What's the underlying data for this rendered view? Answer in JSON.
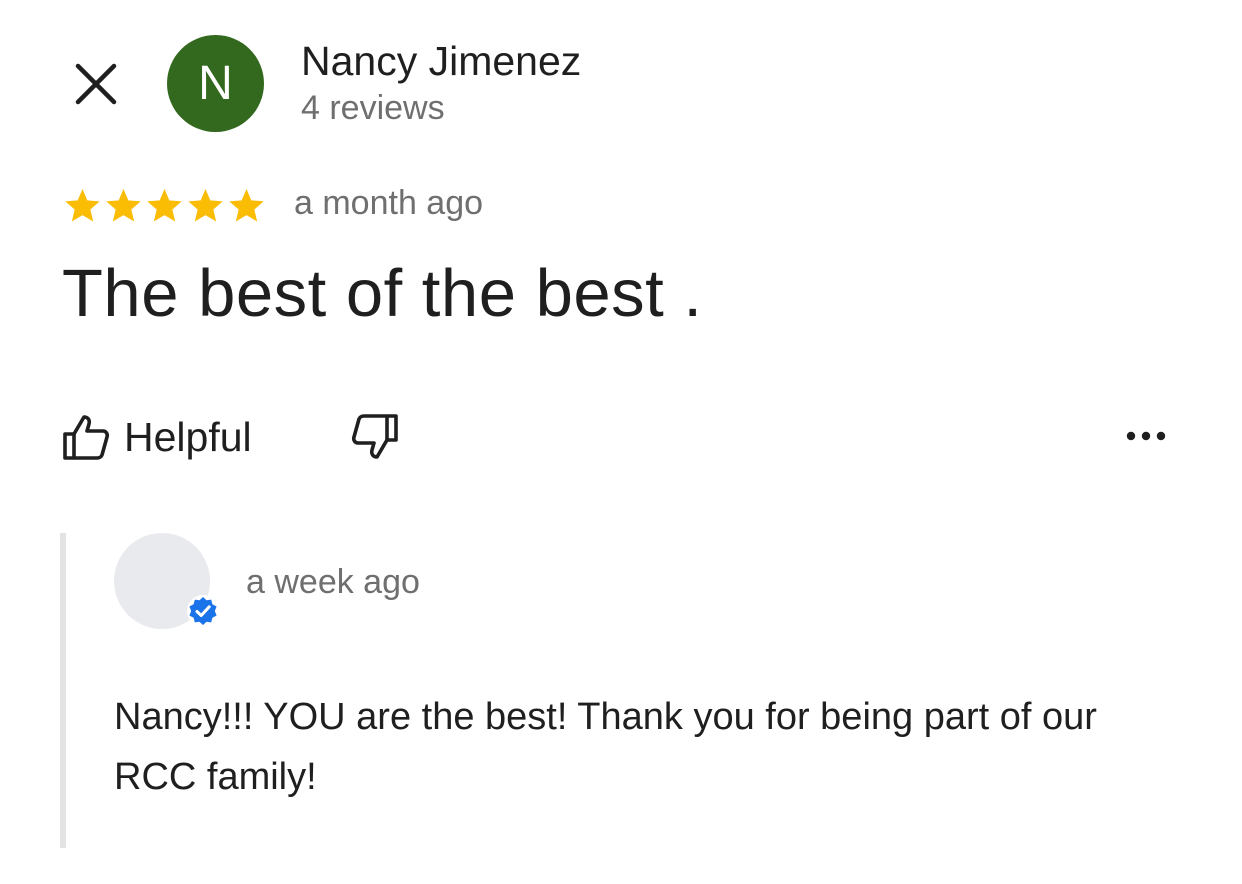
{
  "header": {
    "close_icon": "close-icon",
    "avatar_letter": "N",
    "avatar_color": "#33691e",
    "author_name": "Nancy Jimenez",
    "author_meta": "4 reviews"
  },
  "review": {
    "rating": 5,
    "rating_max": 5,
    "star_color": "#fbbc04",
    "date": "a month ago",
    "text": "The best of the best ."
  },
  "actions": {
    "helpful_label": "Helpful",
    "helpful_icon": "thumbs-up-icon",
    "unhelpful_icon": "thumbs-down-icon",
    "more_icon": "more-horizontal-icon"
  },
  "owner_response": {
    "avatar_icon": "owner-avatar",
    "verified_icon": "verified-badge-icon",
    "verified_color": "#1a73e8",
    "date": "a week ago",
    "text": "Nancy!!! YOU are the best! Thank you for being part of our RCC family!"
  }
}
